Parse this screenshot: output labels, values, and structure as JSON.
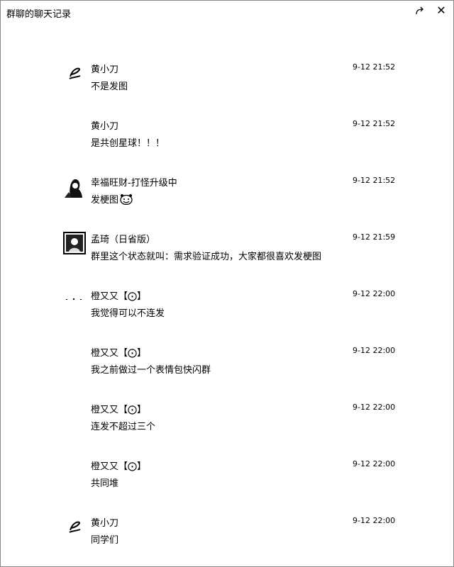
{
  "window": {
    "title": "群聊的聊天记录",
    "icons": {
      "share": "share-arrow-icon",
      "close": "close-icon"
    },
    "close_glyph": "✕"
  },
  "messages": [
    {
      "sender": "黄小刀",
      "time": "9-12 21:52",
      "text": "不是发图",
      "avatar": "feather-logo"
    },
    {
      "sender": "黄小刀",
      "time": "9-12 21:52",
      "text": "是共创星球！！！",
      "avatar": "none"
    },
    {
      "sender": "幸福旺财-打怪升级中",
      "time": "9-12 21:52",
      "text": "发梗图",
      "avatar": "photo-silhouette",
      "emoji": "grin-face-emoji"
    },
    {
      "sender": "孟琦（日省版）",
      "time": "9-12 21:59",
      "text": "群里这个状态就叫：需求验证成功，大家都很喜欢发梗图",
      "avatar": "photo-framed"
    },
    {
      "sender": "橙又又【⨀】",
      "time": "9-12 22:00",
      "text": "我觉得可以不连发",
      "avatar": "small-dots"
    },
    {
      "sender": "橙又又【⨀】",
      "time": "9-12 22:00",
      "text": "我之前做过一个表情包快闪群",
      "avatar": "none"
    },
    {
      "sender": "橙又又【⨀】",
      "time": "9-12 22:00",
      "text": "连发不超过三个",
      "avatar": "none"
    },
    {
      "sender": "橙又又【⨀】",
      "time": "9-12 22:00",
      "text": "共同堆",
      "avatar": "none"
    },
    {
      "sender": "黄小刀",
      "time": "9-12 22:00",
      "text": "同学们",
      "avatar": "feather-logo"
    }
  ]
}
